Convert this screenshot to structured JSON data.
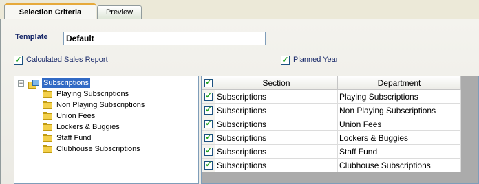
{
  "tabs": [
    {
      "label": "Selection Criteria",
      "active": true
    },
    {
      "label": "Preview",
      "active": false
    }
  ],
  "template": {
    "label": "Template",
    "value": "Default"
  },
  "options": {
    "calculated_sales_report": {
      "label": "Calculated Sales Report",
      "checked": true
    },
    "planned_year": {
      "label": "Planned Year",
      "checked": true
    }
  },
  "tree": {
    "root": {
      "label": "Subscriptions",
      "expanded": true,
      "expander": "−"
    },
    "children": [
      "Playing Subscriptions",
      "Non Playing Subscriptions",
      "Union Fees",
      "Lockers & Buggies",
      "Staff Fund",
      "Clubhouse Subscriptions"
    ]
  },
  "grid": {
    "columns": [
      "Section",
      "Department"
    ],
    "rows": [
      {
        "checked": true,
        "section": "Subscriptions",
        "department": "Playing Subscriptions"
      },
      {
        "checked": true,
        "section": "Subscriptions",
        "department": "Non Playing Subscriptions"
      },
      {
        "checked": true,
        "section": "Subscriptions",
        "department": "Union Fees"
      },
      {
        "checked": true,
        "section": "Subscriptions",
        "department": "Lockers & Buggies"
      },
      {
        "checked": true,
        "section": "Subscriptions",
        "department": "Staff Fund"
      },
      {
        "checked": true,
        "section": "Subscriptions",
        "department": "Clubhouse Subscriptions"
      }
    ]
  },
  "glyphs": {
    "check": "✓"
  },
  "colors": {
    "accent": "#316ac5",
    "label_text": "#1a2a6a",
    "check_tick": "#21a121"
  }
}
